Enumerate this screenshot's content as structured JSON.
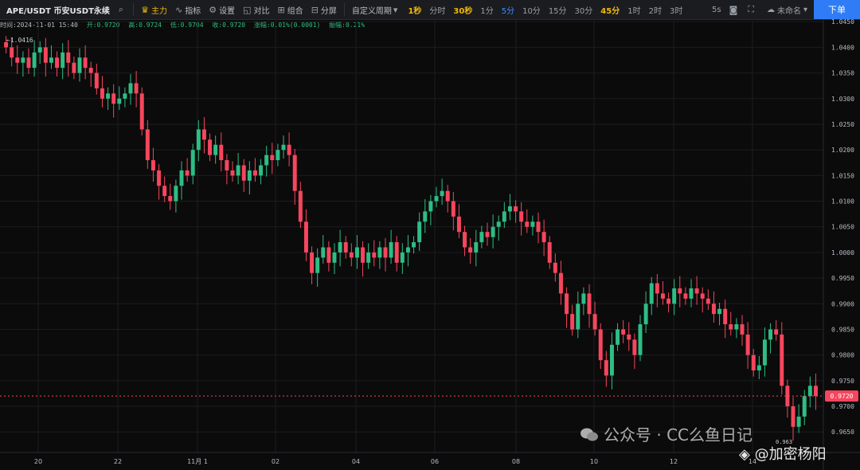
{
  "toolbar": {
    "symbol": "APE/USDT 币安USDT永续",
    "main_label": "主力",
    "indicator_label": "指标",
    "settings_label": "设置",
    "compare_label": "对比",
    "combo_label": "组合",
    "split_label": "分屏",
    "custom_period_label": "自定义周期",
    "periods": [
      "1秒",
      "分时",
      "30秒",
      "1分",
      "5分",
      "10分",
      "15分",
      "30分",
      "45分",
      "1时",
      "2时",
      "3时"
    ],
    "highlighted_periods": [
      "1秒",
      "30秒",
      "45分"
    ],
    "selected_period": "5分",
    "interval_label": "5s",
    "layout_name": "未命名",
    "order_label": "下单"
  },
  "info": {
    "time": "时间:2024-11-01 15:40",
    "open": "开:0.9720",
    "high": "高:0.9724",
    "low": "低:0.9704",
    "close": "收:0.9720",
    "change": "涨幅:0.01%(0.0001)",
    "amplitude": "振幅:0.21%"
  },
  "annotations": {
    "high_marker": "←1.0416",
    "low_marker": "0.963"
  },
  "chart_data": {
    "type": "candlestick",
    "ylim": [
      0.961,
      1.0455
    ],
    "y_ticks": [
      "1.0450",
      "1.0400",
      "1.0350",
      "1.0300",
      "1.0250",
      "1.0200",
      "1.0150",
      "1.0100",
      "1.0050",
      "1.0000",
      "0.9950",
      "0.9900",
      "0.9850",
      "0.9800",
      "0.9750",
      "0.9700",
      "0.9650"
    ],
    "x_ticks": [
      "20",
      "22",
      "11月 1",
      "02",
      "04",
      "06",
      "08",
      "10",
      "12",
      "14"
    ],
    "current_price": "0.9720",
    "up_color": "#2ebd85",
    "down_color": "#f6465d",
    "closes": [
      1.04,
      1.038,
      1.037,
      1.038,
      1.036,
      1.039,
      1.04,
      1.037,
      1.038,
      1.036,
      1.039,
      1.037,
      1.035,
      1.038,
      1.036,
      1.035,
      1.032,
      1.03,
      1.031,
      1.029,
      1.03,
      1.031,
      1.033,
      1.031,
      1.024,
      1.018,
      1.016,
      1.013,
      1.011,
      1.01,
      1.013,
      1.016,
      1.015,
      1.02,
      1.024,
      1.022,
      1.019,
      1.021,
      1.018,
      1.016,
      1.015,
      1.017,
      1.014,
      1.016,
      1.015,
      1.017,
      1.019,
      1.018,
      1.02,
      1.021,
      1.019,
      1.012,
      1.006,
      1.0,
      0.996,
      0.999,
      1.001,
      0.998,
      1.0,
      1.002,
      1.0,
      0.999,
      1.001,
      0.998,
      1.0,
      0.999,
      1.001,
      0.999,
      1.002,
      0.998,
      1.0,
      1.001,
      1.002,
      1.006,
      1.008,
      1.01,
      1.011,
      1.012,
      1.01,
      1.007,
      1.004,
      1.001,
      1.0,
      1.002,
      1.004,
      1.003,
      1.005,
      1.006,
      1.008,
      1.009,
      1.008,
      1.006,
      1.005,
      1.006,
      1.004,
      1.002,
      0.998,
      0.996,
      0.992,
      0.988,
      0.985,
      0.99,
      0.992,
      0.988,
      0.985,
      0.979,
      0.976,
      0.982,
      0.985,
      0.984,
      0.983,
      0.98,
      0.986,
      0.99,
      0.994,
      0.992,
      0.991,
      0.99,
      0.993,
      0.992,
      0.991,
      0.993,
      0.992,
      0.991,
      0.99,
      0.988,
      0.989,
      0.986,
      0.985,
      0.986,
      0.984,
      0.98,
      0.977,
      0.978,
      0.983,
      0.985,
      0.984,
      0.974,
      0.97,
      0.966,
      0.968,
      0.972,
      0.974,
      0.972
    ],
    "high": 1.0416,
    "low": 0.963
  }
}
